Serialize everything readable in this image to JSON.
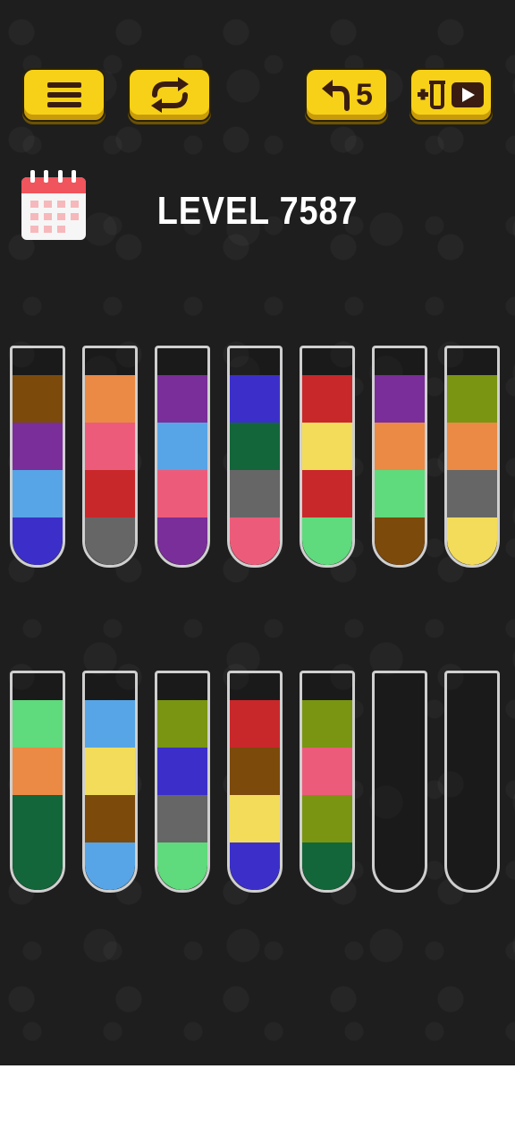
{
  "level": {
    "title": "LEVEL 7587"
  },
  "toolbar": {
    "undo_count": "5"
  },
  "colors": {
    "button_yellow": "#f7d117",
    "icon_brown": "#3a1d10",
    "calendar_red": "#f0545c"
  },
  "tubes": [
    {
      "id": 1,
      "layers_bottom_to_top": [
        "#3c2fc9",
        "#57a5e6",
        "#7a2e99",
        "#7c4a0b"
      ]
    },
    {
      "id": 2,
      "layers_bottom_to_top": [
        "#666666",
        "#c8282a",
        "#ec5c7a",
        "#ea8a44"
      ]
    },
    {
      "id": 3,
      "layers_bottom_to_top": [
        "#7a2e99",
        "#ec5c7a",
        "#57a5e6",
        "#7a2e99"
      ]
    },
    {
      "id": 4,
      "layers_bottom_to_top": [
        "#ec5c7a",
        "#666666",
        "#13663a",
        "#3c2fc9"
      ]
    },
    {
      "id": 5,
      "layers_bottom_to_top": [
        "#5fda7c",
        "#c8282a",
        "#f3dc5a",
        "#c8282a"
      ]
    },
    {
      "id": 6,
      "layers_bottom_to_top": [
        "#7c4a0b",
        "#5fda7c",
        "#ea8a44",
        "#7a2e99"
      ]
    },
    {
      "id": 7,
      "layers_bottom_to_top": [
        "#f3dc5a",
        "#666666",
        "#ea8a44",
        "#7a9512"
      ]
    },
    {
      "id": 8,
      "layers_bottom_to_top": [
        "#13663a",
        "#13663a",
        "#ea8a44",
        "#5fda7c"
      ]
    },
    {
      "id": 9,
      "layers_bottom_to_top": [
        "#57a5e6",
        "#7c4a0b",
        "#f3dc5a",
        "#57a5e6"
      ]
    },
    {
      "id": 10,
      "layers_bottom_to_top": [
        "#5fda7c",
        "#666666",
        "#3c2fc9",
        "#7a9512"
      ]
    },
    {
      "id": 11,
      "layers_bottom_to_top": [
        "#3c2fc9",
        "#f3dc5a",
        "#7c4a0b",
        "#c8282a"
      ]
    },
    {
      "id": 12,
      "layers_bottom_to_top": [
        "#13663a",
        "#7a9512",
        "#ec5c7a",
        "#7a9512"
      ]
    },
    {
      "id": 13,
      "layers_bottom_to_top": []
    },
    {
      "id": 14,
      "layers_bottom_to_top": []
    }
  ],
  "icons": {
    "menu": "hamburger-menu-icon",
    "restart": "restart-icon",
    "undo": "undo-icon",
    "add_tube": "add-tube-video-icon",
    "calendar": "calendar-icon"
  }
}
